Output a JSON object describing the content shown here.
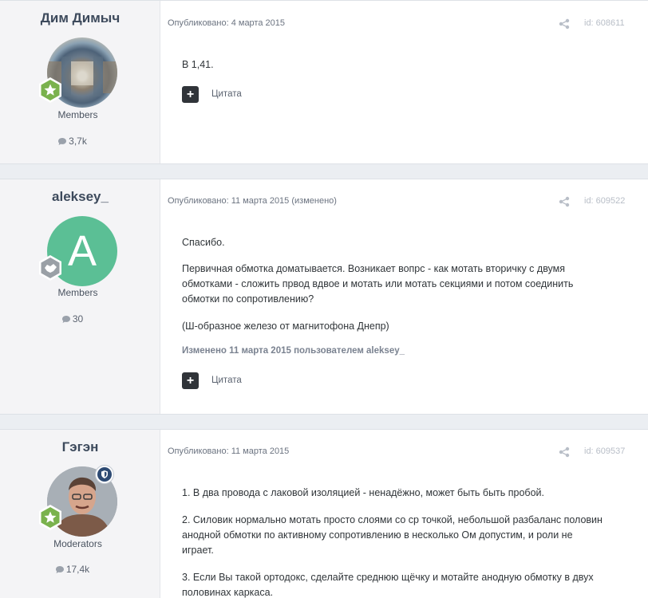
{
  "posts": [
    {
      "author": "Дим Димыч",
      "group": "Members",
      "post_count": "3,7k",
      "meta": "Опубликовано: 4 марта 2015",
      "id": "id: 608611",
      "paragraphs": [
        "В 1,41."
      ],
      "edited": "",
      "quote_label": "Цитата",
      "avatar_kind": "photo-tunnel",
      "rank_icon": "star-badge-icon"
    },
    {
      "author": "aleksey_",
      "group": "Members",
      "post_count": "30",
      "meta": "Опубликовано: 11 марта 2015 (изменено)",
      "id": "id: 609522",
      "paragraphs": [
        "Спасибо.",
        "Первичная обмотка доматывается. Возникает вопрс - как мотать вторичку с двумя",
        "обмотками - сложить првод вдвое и мотать или мотать секциями и потом соединить",
        "обмотки по сопротивлению?",
        "(Ш-образное железо от магнитофона Днепр)"
      ],
      "edited": "Изменено 11 марта 2015 пользователем aleksey_",
      "quote_label": "Цитата",
      "avatar_letter": "A",
      "avatar_color": "#5bbf95",
      "rank_icon": "handshake-badge-icon"
    },
    {
      "author": "Гэгэн",
      "group": "Moderators",
      "post_count": "17,4k",
      "meta": "Опубликовано: 11 марта 2015",
      "id": "id: 609537",
      "paragraphs": [
        "1. В два провода с лаковой изоляцией - ненадёжно, может быть быть пробой.",
        "2. Силовик нормально мотать просто слоями со ср точкой, небольшой разбаланс половин",
        "анодной обмотки по активному сопротивлению в несколько Ом допустим, и роли не",
        "играет.",
        "3. Если Вы такой ортодокс, сделайте среднюю щёчку и мотайте анодную обмотку в двух",
        "половинах каркаса."
      ],
      "rank_icon": "star-badge-icon",
      "mod_icon": "shield-icon"
    }
  ],
  "colors": {
    "accent_green": "#6aa84f",
    "letter_avatar": "#5bbf95",
    "mod_blue": "#2d4a73"
  }
}
